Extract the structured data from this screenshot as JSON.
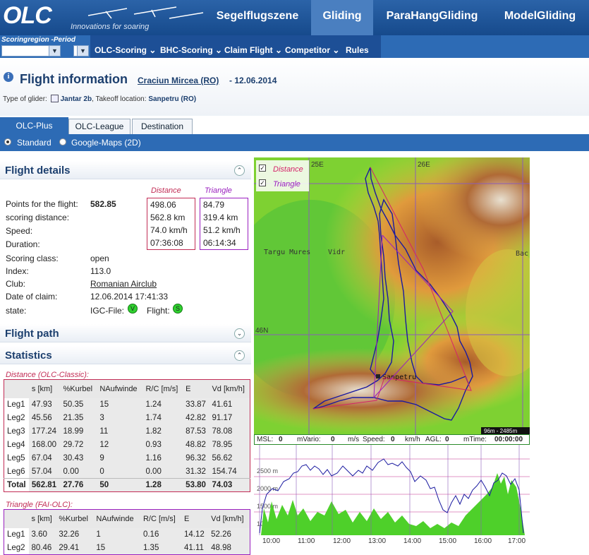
{
  "header": {
    "logo_text": "OLC",
    "logo_tagline": "Innovations for soaring",
    "category_tabs": [
      "Segelflugszene",
      "Gliding",
      "ParaHangGliding",
      "ModelGliding"
    ],
    "active_tab": "Gliding"
  },
  "subnav": {
    "region_label": "Scoringregion -Period",
    "menu": [
      "OLC-Scoring",
      "BHC-Scoring",
      "Claim Flight",
      "Competitor",
      "Rules"
    ]
  },
  "page": {
    "title": "Flight information",
    "pilot": "Craciun Mircea (RO)",
    "date_text": "- 12.06.2014",
    "type_label": "Type of glider:",
    "glider": "Jantar 2b",
    "takeoff_label": ", Takeoff location:",
    "takeoff": "Sanpetru (RO)"
  },
  "tabs": [
    "OLC-Plus",
    "OLC-League",
    "Destination"
  ],
  "view_options": {
    "standard": "Standard",
    "google": "Google-Maps (2D)"
  },
  "flight_details": {
    "header": "Flight details",
    "distance_head": "Distance",
    "triangle_head": "Triangle",
    "points_label": "Points for the flight:",
    "points_value": "582.85",
    "rows_labels": [
      "scoring distance:",
      "Speed:",
      "Duration:"
    ],
    "distance_values": [
      "498.06",
      "562.8 km",
      "74.0 km/h",
      "07:36:08"
    ],
    "triangle_values": [
      "84.79",
      "319.4 km",
      "51.2 km/h",
      "06:14:34"
    ],
    "scoring_class_label": "Scoring class:",
    "scoring_class": "open",
    "index_label": "Index:",
    "index": "113.0",
    "club_label": "Club:",
    "club": "Romanian Airclub",
    "date_label": "Date of claim:",
    "date": "12.06.2014 17:41:33",
    "state_label": "state:",
    "igc_label": "IGC-File:",
    "flight_label": "Flight:",
    "igc_badge": "V",
    "flight_badge": "S"
  },
  "flight_path": {
    "header": "Flight path"
  },
  "statistics": {
    "header": "Statistics",
    "distance_caption": "Distance (OLC-Classic):",
    "triangle_caption": "Triangle (FAI-OLC):",
    "columns": [
      "s [km]",
      "%Kurbel",
      "NAufwinde",
      "R/C [m/s]",
      "E",
      "Vd [km/h]"
    ],
    "distance_rows": [
      [
        "Leg1",
        "47.93",
        "50.35",
        "15",
        "1.24",
        "33.87",
        "41.61"
      ],
      [
        "Leg2",
        "45.56",
        "21.35",
        "3",
        "1.74",
        "42.82",
        "91.17"
      ],
      [
        "Leg3",
        "177.24",
        "18.99",
        "11",
        "1.82",
        "87.53",
        "78.08"
      ],
      [
        "Leg4",
        "168.00",
        "29.72",
        "12",
        "0.93",
        "48.82",
        "78.95"
      ],
      [
        "Leg5",
        "67.04",
        "30.43",
        "9",
        "1.16",
        "96.32",
        "56.62"
      ],
      [
        "Leg6",
        "57.04",
        "0.00",
        "0",
        "0.00",
        "31.32",
        "154.74"
      ],
      [
        "Total",
        "562.81",
        "27.76",
        "50",
        "1.28",
        "53.80",
        "74.03"
      ]
    ],
    "triangle_rows": [
      [
        "Leg1",
        "3.60",
        "32.26",
        "1",
        "0.16",
        "14.12",
        "52.26"
      ],
      [
        "Leg2",
        "80.46",
        "29.41",
        "15",
        "1.35",
        "41.11",
        "48.98"
      ]
    ]
  },
  "map": {
    "legend_distance": "Distance",
    "legend_triangle": "Triangle",
    "grid_labels": [
      "25E",
      "26E",
      "46N"
    ],
    "place_labels": [
      "Targu Mures",
      "Vidr",
      "Bac",
      "Sanpetru"
    ],
    "scale_label": "96m - 2485m",
    "colors": {
      "distance": "#d4246a",
      "triangle": "#9a1fbf",
      "track": "#1a1aa0"
    }
  },
  "barogram": {
    "readout": {
      "msl_label": "MSL:",
      "msl": "0",
      "mvario_label": "mVario:",
      "mvario": "0",
      "mvario_unit": "m/s",
      "speed_label": "Speed:",
      "speed": "0",
      "speed_unit": "km/h",
      "agl_label": "AGL:",
      "agl": "0",
      "mtime_label": "mTime:",
      "mtime": "00:00:00"
    },
    "y_ticks": [
      "2500 m",
      "2000 m",
      "1500 m",
      "1000 m"
    ],
    "x_ticks": [
      "10:00",
      "11:00",
      "12:00",
      "13:00",
      "14:00",
      "15:00",
      "16:00",
      "17:00"
    ]
  }
}
